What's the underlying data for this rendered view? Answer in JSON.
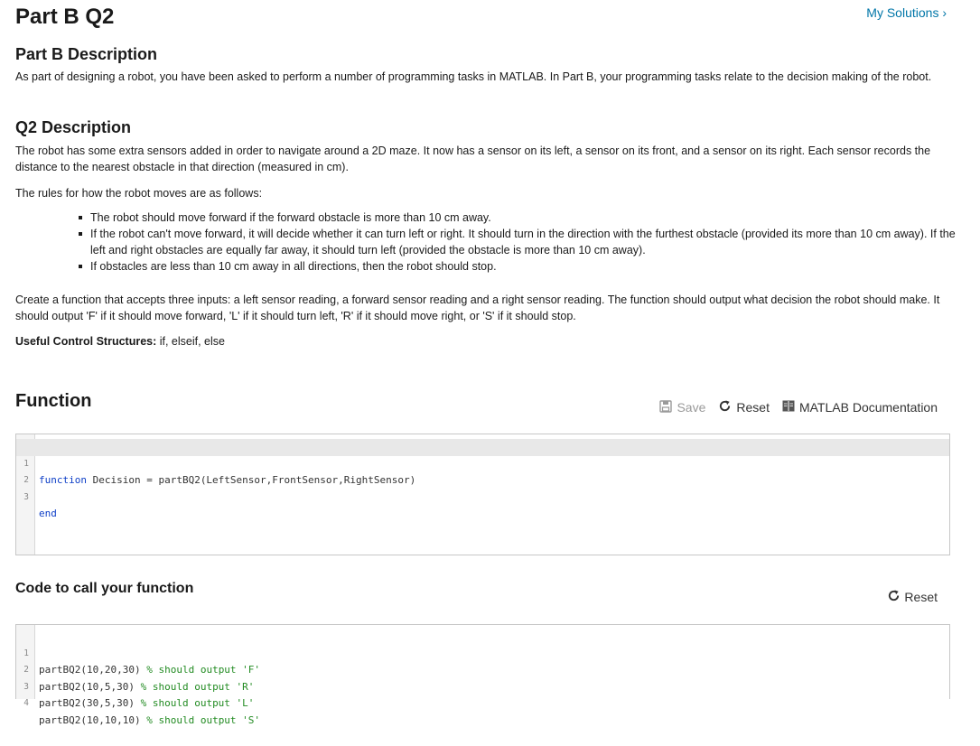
{
  "header": {
    "title": "Part B Q2",
    "my_solutions": "My Solutions ›"
  },
  "part_b": {
    "heading": "Part B Description",
    "text": "As part of designing a robot, you have been asked to perform a number of programming tasks in MATLAB.  In Part B, your programming tasks relate to the decision making of the robot."
  },
  "q2": {
    "heading": "Q2 Description",
    "para1": "The robot has some extra sensors added in order to navigate around a 2D maze. It now has a sensor on its left, a sensor on its front, and a sensor on its right. Each sensor records the distance to the nearest obstacle in that direction (measured in cm).",
    "para2": "The rules for how the robot moves are as follows:",
    "rules": [
      "The robot should move forward if the forward obstacle is more than 10 cm away.",
      "If the robot can't move forward, it will decide whether it can turn left or right. It should turn in the direction with the furthest obstacle (provided its more than 10 cm away). If the left and right obstacles are equally far away, it should turn left (provided the obstacle is more than 10 cm away).",
      "If obstacles are less than 10 cm away in all directions, then the robot should stop."
    ],
    "para3": "Create a function that accepts three inputs: a left sensor reading, a forward sensor reading and a right sensor reading. The function should output what decision the robot should make. It should output 'F' if it should move forward, 'L' if it should turn left, 'R' if it should move right, or 'S' if it should stop.",
    "useful_label": "Useful Control Structures:",
    "useful_value": " if, elseif, else"
  },
  "function_section": {
    "heading": "Function",
    "save": "Save",
    "reset": "Reset",
    "docs": "MATLAB Documentation",
    "lines": [
      {
        "n": "1",
        "kw": "function",
        "rest": " Decision = partBQ2(LeftSensor,FrontSensor,RightSensor)"
      },
      {
        "n": "2",
        "kw": "",
        "rest": ""
      },
      {
        "n": "3",
        "kw": "end",
        "rest": ""
      }
    ]
  },
  "call_section": {
    "heading": "Code to call your function",
    "reset": "Reset",
    "lines": [
      {
        "n": "1",
        "code": "partBQ2(10,20,30) ",
        "comment": "% should output 'F'"
      },
      {
        "n": "2",
        "code": "partBQ2(10,5,30) ",
        "comment": "% should output 'R'"
      },
      {
        "n": "3",
        "code": "partBQ2(30,5,30) ",
        "comment": "% should output 'L'"
      },
      {
        "n": "4",
        "code": "partBQ2(10,10,10) ",
        "comment": "% should output 'S'"
      }
    ]
  },
  "colors": {
    "link": "#0076a8",
    "keyword": "#0e3fc7",
    "comment": "#228b22"
  }
}
